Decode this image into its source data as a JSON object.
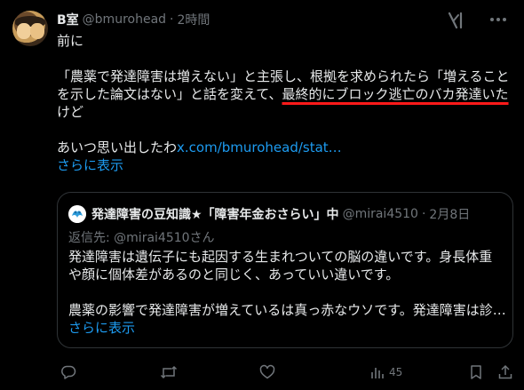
{
  "post": {
    "display_name": "B室",
    "handle": "@bmurohead",
    "separator": "·",
    "time": "2時間",
    "lines": [
      "前に",
      "",
      "「農薬で発達障害は増えない」と主張し、根拠を求められたら「増えること",
      "を示した論文はない」と話を変えて、",
      "けど",
      "",
      "あいつ思い出したわ"
    ],
    "underlined_segment": "最終的にブロック逃亡のバカ発達いた",
    "link_text": "x.com/bmurohead/stat…",
    "show_more": "さらに表示"
  },
  "quote": {
    "display_name": "発達障害の豆知識★「障害年金おさらい」中",
    "handle": "@mirai4510",
    "separator": "·",
    "date": "2月8日",
    "reply_to": "返信先: @mirai4510さん",
    "lines": [
      "発達障害は遺伝子にも起因する生まれついての脳の違いです。身長体重",
      "や顔に個体差があるのと同じく、あっていい違いです。",
      "",
      "農薬の影響で発達障害が増えているは真っ赤なウソです。発達障害は診…"
    ],
    "show_more": "さらに表示"
  },
  "actions": {
    "views": "45"
  },
  "icons": {
    "grok": "grok-icon",
    "more": "more-icon",
    "reply": "reply-icon",
    "repost": "repost-icon",
    "like": "like-icon",
    "views": "views-icon",
    "bookmark": "bookmark-icon",
    "share": "share-icon"
  },
  "colors": {
    "background": "#000000",
    "text": "#e7e9ea",
    "muted": "#71767b",
    "link": "#1d9bf0",
    "underline": "#ff1a1a",
    "border": "#2f3336"
  }
}
